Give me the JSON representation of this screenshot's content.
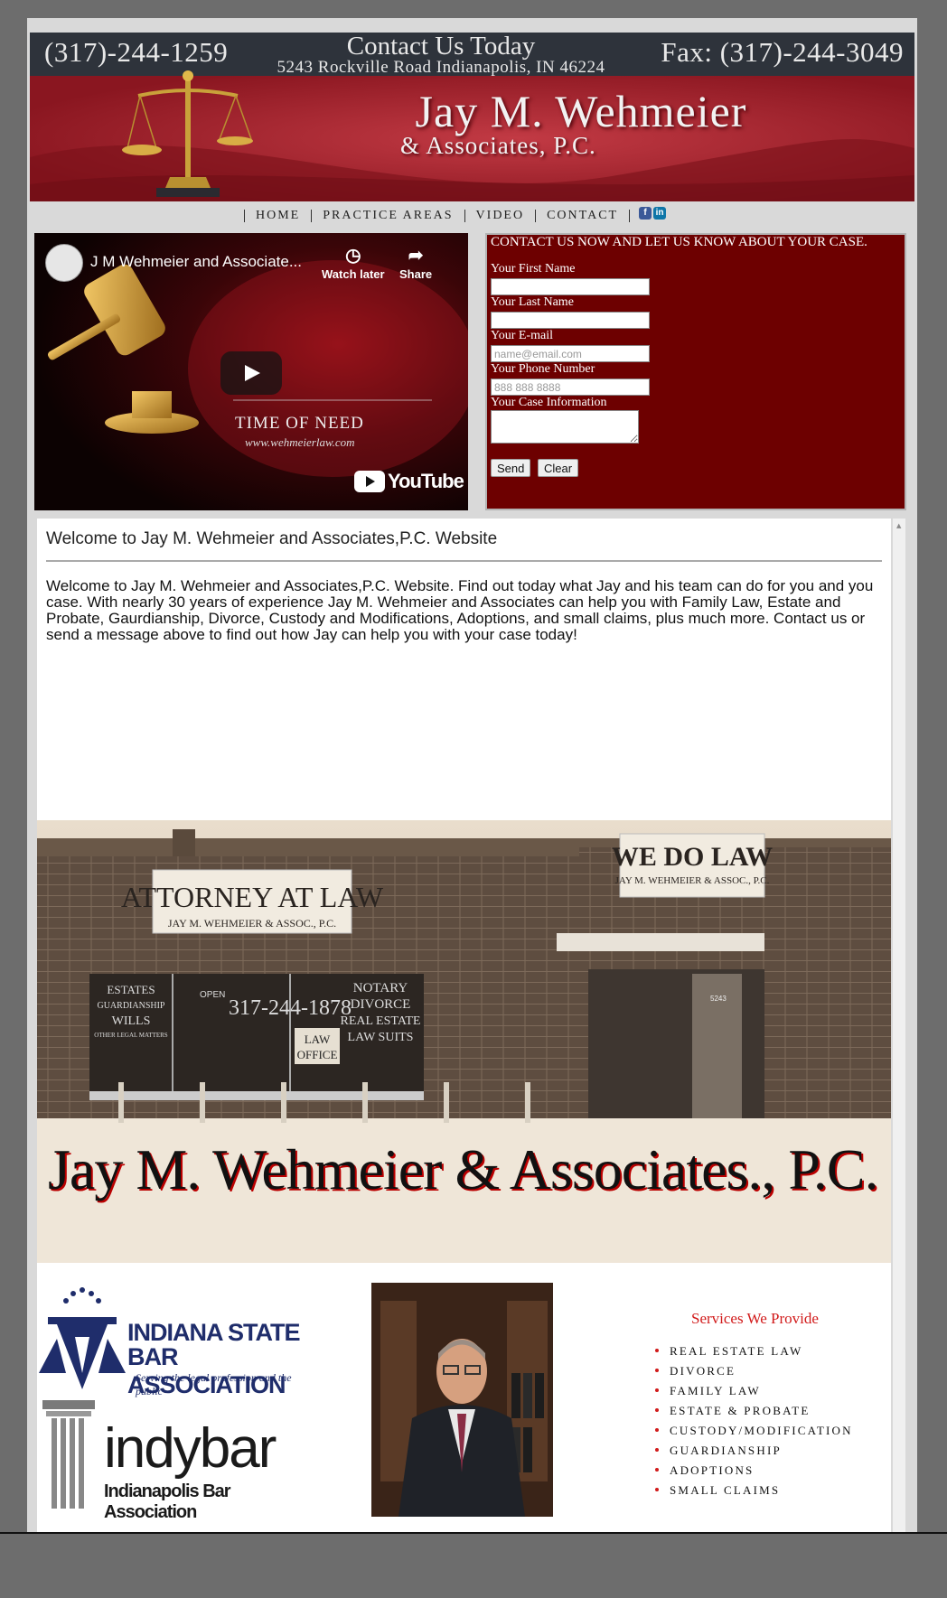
{
  "header": {
    "phone": "(317)-244-1259",
    "contact_heading": "Contact Us Today",
    "address": "5243 Rockville Road  Indianapolis, IN  46224",
    "fax": "Fax: (317)-244-3049",
    "firm_name": "Jay M. Wehmeier",
    "firm_sub": "& Associates, P.C."
  },
  "nav": {
    "items": [
      {
        "label": "HOME"
      },
      {
        "label": "PRACTICE AREAS"
      },
      {
        "label": "VIDEO"
      },
      {
        "label": "CONTACT"
      }
    ],
    "social": [
      {
        "icon": "facebook-icon",
        "glyph": "f"
      },
      {
        "icon": "linkedin-icon",
        "glyph": "in"
      }
    ]
  },
  "video": {
    "title": "J M Wehmeier and Associate...",
    "watch_later": "Watch later",
    "share": "Share",
    "overlay_text": "TIME OF NEED",
    "overlay_url": "www.wehmeierlaw.com",
    "platform": "YouTube"
  },
  "form": {
    "heading": "CONTACT US NOW AND LET US KNOW ABOUT YOUR CASE.",
    "first_name_label": "Your First Name",
    "last_name_label": "Your Last Name",
    "email_label": "Your E-mail",
    "email_placeholder": "name@email.com",
    "phone_label": "Your Phone Number",
    "phone_placeholder": "888 888 8888",
    "case_label": "Your Case Information",
    "send_label": "Send",
    "clear_label": "Clear"
  },
  "content": {
    "welcome_title": "Welcome to Jay M. Wehmeier and Associates,P.C. Website",
    "welcome_text": "Welcome to Jay M. Wehmeier and Associates,P.C. Website. Find out today what Jay and his team can do for you and you case. With nearly 30 years of experience Jay M. Wehmeier and Associates can help you with Family Law, Estate and Probate, Gaurdianship, Divorce, Custody and Modifications, Adoptions, and small claims, plus much more. Contact us or send a message above to find out how Jay can help you with your case today!",
    "photo": {
      "sign_main": "ATTORNEY AT LAW",
      "sign_sub": "JAY M. WEHMEIER & ASSOC., P.C.",
      "sign_right": "WE DO LAW",
      "sign_right_sub": "JAY M. WEHMEIER & ASSOC., P.C.",
      "window_left": [
        "ESTATES",
        "GUARDIANSHIP",
        "WILLS",
        "OTHER LEGAL MATTERS"
      ],
      "window_mid_phone": "317-244-1878",
      "window_open": "OPEN",
      "window_office": [
        "LAW",
        "OFFICE"
      ],
      "window_right": [
        "NOTARY",
        "DIVORCE",
        "REAL ESTATE",
        "LAW SUITS"
      ],
      "door_number": "5243",
      "caption": "Jay M. Wehmeier & Associates., P.C."
    },
    "isba": {
      "line1": "INDIANA STATE",
      "line2": "BAR ASSOCIATION",
      "tagline": "Serving the legal profession and the public"
    },
    "indybar": {
      "name": "indybar",
      "sub": "Indianapolis Bar Association"
    },
    "services_title": "Services We Provide",
    "services": [
      "Real Estate Law",
      "Divorce",
      "Family Law",
      "Estate & Probate",
      "Custody/Modification",
      "Guardianship",
      "Adoptions",
      "Small Claims"
    ]
  },
  "colors": {
    "banner_red": "#9b1a25",
    "form_red": "#6d0000",
    "service_bullet": "#d11a1a"
  }
}
